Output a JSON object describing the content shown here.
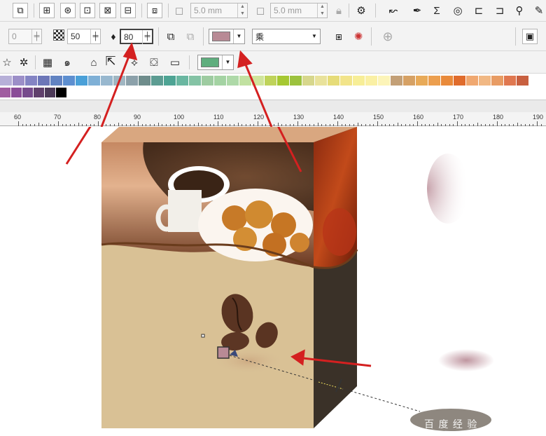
{
  "toolbar1": {
    "outline_width_1": "5.0 mm",
    "outline_width_2": "5.0 mm"
  },
  "toolbar2": {
    "opacity_input": "0",
    "feather_input": "50",
    "shadow_value": "80",
    "merge_mode": "乘",
    "shadow_color": "#b88a95"
  },
  "toolbar3": {
    "fill_color": "#5fae7e"
  },
  "palette": {
    "row1": [
      "#b7b0d8",
      "#9c8fc8",
      "#8484c4",
      "#6c76b8",
      "#6183c2",
      "#5d8fd0",
      "#4aa0d8",
      "#7fb0d6",
      "#98b8cf",
      "#a0b6c2",
      "#8ca1aa",
      "#6f8d8c",
      "#5c9c92",
      "#4ea494",
      "#6ab7a1",
      "#84c3a5",
      "#9ecca1",
      "#a4d3a3",
      "#aed9a8",
      "#c1e1a1",
      "#d0e59c",
      "#bfd35a",
      "#a6c832",
      "#9cc23e",
      "#d7d78c",
      "#e9e29b",
      "#e6dc79",
      "#f2e48a",
      "#f7ee97",
      "#faf0a4",
      "#fcf4b8",
      "#c3a077",
      "#d6a164",
      "#e8aa58",
      "#ec9f4f",
      "#e98a3a",
      "#e06c2c",
      "#f0a870",
      "#f1b884",
      "#e89c64",
      "#e07850",
      "#c86040"
    ],
    "row2": [
      "#a05ca0",
      "#8a4c98",
      "#764a8c",
      "#60406c",
      "#4c3a58",
      "#000000"
    ]
  },
  "ruler": {
    "labels": [
      "60",
      "70",
      "80",
      "90",
      "100",
      "110",
      "120",
      "130",
      "140",
      "150",
      "160",
      "170",
      "180",
      "190"
    ]
  },
  "canvas": {
    "watermark": "百 度 经 验"
  }
}
